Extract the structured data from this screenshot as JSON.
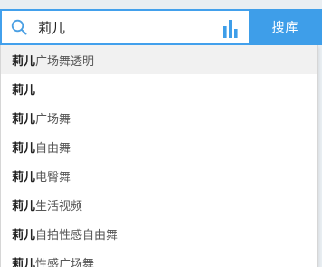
{
  "search": {
    "value": "莉儿",
    "button_label": "搜库",
    "icons": {
      "search": "search-icon",
      "chart": "bar-chart-icon"
    },
    "accent_color": "#3e9ee9"
  },
  "suggestions": [
    {
      "keyword": "莉儿",
      "rest": "广场舞透明"
    },
    {
      "keyword": "莉儿",
      "rest": ""
    },
    {
      "keyword": "莉儿",
      "rest": "广场舞"
    },
    {
      "keyword": "莉儿",
      "rest": "自由舞"
    },
    {
      "keyword": "莉儿",
      "rest": "电臀舞"
    },
    {
      "keyword": "莉儿",
      "rest": "生活视频"
    },
    {
      "keyword": "莉儿",
      "rest": "自拍性感自由舞"
    },
    {
      "keyword": "莉儿",
      "rest": "性感广场舞"
    }
  ]
}
